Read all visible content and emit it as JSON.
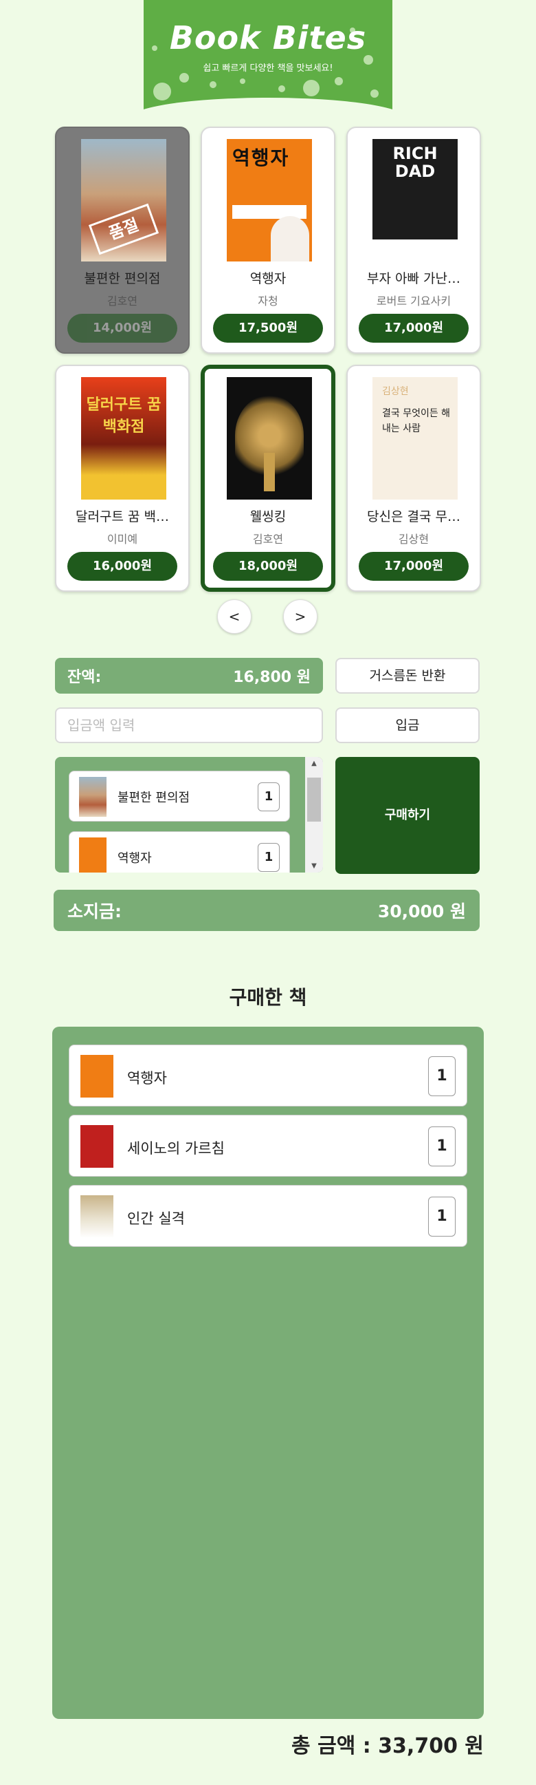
{
  "banner": {
    "title": "Book Bites",
    "subtitle": "쉽고 빠르게 다양한 책을 맛보세요!"
  },
  "books": [
    {
      "title": "불편한 편의점",
      "author": "김호연",
      "price": "14,000원",
      "status": "품절"
    },
    {
      "title": "역행자",
      "author": "자청",
      "price": "17,500원",
      "cover_text": "역행자"
    },
    {
      "title": "부자 아빠 가난…",
      "author": "로버트 기요사키",
      "price": "17,000원",
      "cover_text": "RICH DAD"
    },
    {
      "title": "달러구트 꿈 백…",
      "author": "이미예",
      "price": "16,000원",
      "cover_text": "달러구트 꿈 백화점"
    },
    {
      "title": "웰씽킹",
      "author": "김호연",
      "price": "18,000원"
    },
    {
      "title": "당신은 결국 무…",
      "author": "김상현",
      "price": "17,000원",
      "cover_text": "결국 무엇이든 해내는 사람",
      "cover_author": "김상현"
    }
  ],
  "pager": {
    "prev": "<",
    "next": ">"
  },
  "controls": {
    "balance_label": "잔액:",
    "balance_value": "16,800 원",
    "change_button": "거스름돈 반환",
    "deposit_placeholder": "입금액 입력",
    "deposit_button": "입금",
    "buy_button": "구매하기"
  },
  "cart": [
    {
      "name": "불편한 편의점",
      "qty": "1"
    },
    {
      "name": "역행자",
      "qty": "1"
    }
  ],
  "wallet": {
    "label": "소지금:",
    "value": "30,000 원"
  },
  "purchased": {
    "title": "구매한 책",
    "items": [
      {
        "name": "역행자",
        "qty": "1"
      },
      {
        "name": "세이노의 가르침",
        "qty": "1"
      },
      {
        "name": "인간 실격",
        "qty": "1"
      }
    ]
  },
  "total": "총 금액 : 33,700 원",
  "colors": {
    "primary": "#1f5a1c",
    "panel": "#7aad76",
    "banner": "#5fae45",
    "background": "#effbe6"
  }
}
